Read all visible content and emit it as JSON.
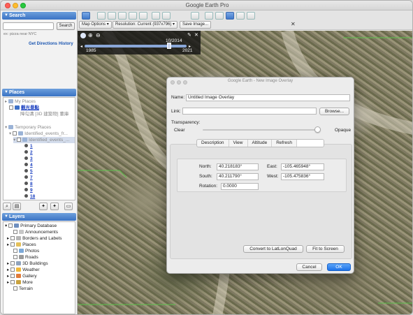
{
  "window": {
    "title": "Google Earth Pro"
  },
  "toolbar": {
    "map_options": "Map Options",
    "resolution": "Resolution: Current (937x796)",
    "save_image": "Save Image...",
    "close_symbol": "✕"
  },
  "sidebar": {
    "search": {
      "header": "Search",
      "input_value": "",
      "button": "Search",
      "hint": "ex: pizza near NYC",
      "get_directions": "Get Directions",
      "history": "History"
    },
    "places": {
      "header": "Places",
      "items": [
        {
          "label": "My Places"
        },
        {
          "label": "觀光景點"
        },
        {
          "label": "障勾溝 [3D 建築物] 董庫"
        },
        {
          "label": "Temporary Places"
        },
        {
          "label": "Identified_events_fr..."
        },
        {
          "label": "Identified_events_..."
        }
      ],
      "numbers": [
        "1",
        "2",
        "3",
        "4",
        "5",
        "7",
        "8",
        "9",
        "18"
      ]
    },
    "layers": {
      "header": "Layers",
      "items": [
        "Primary Database",
        "Announcements",
        "Borders and Labels",
        "Places",
        "Photos",
        "Roads",
        "3D Buildings",
        "Weather",
        "Gallery",
        "More",
        "Terrain"
      ]
    }
  },
  "timeline": {
    "current": "10/2014",
    "start": "1985",
    "end": "2021"
  },
  "dialog": {
    "title": "Google Earth - New Image Overlay",
    "name_label": "Name:",
    "name_value": "Untitled Image Overlay",
    "link_label": "Link:",
    "link_value": "",
    "browse": "Browse...",
    "transparency_label": "Transparency:",
    "transparency_level": 0.95,
    "clear": "Clear",
    "opaque": "Opaque",
    "tabs": [
      "Description",
      "View",
      "Altitude",
      "Refresh"
    ],
    "coords": {
      "north_label": "North:",
      "north": "40.218183°",
      "east_label": "East:",
      "east": "-105.465948°",
      "south_label": "South:",
      "south": "40.211790°",
      "west_label": "West:",
      "west": "-105.475836°",
      "rotation_label": "Rotation:",
      "rotation": "0.0000"
    },
    "convert": "Convert to LatLonQuad",
    "fit": "Fit to Screen",
    "cancel": "Cancel",
    "ok": "OK"
  }
}
